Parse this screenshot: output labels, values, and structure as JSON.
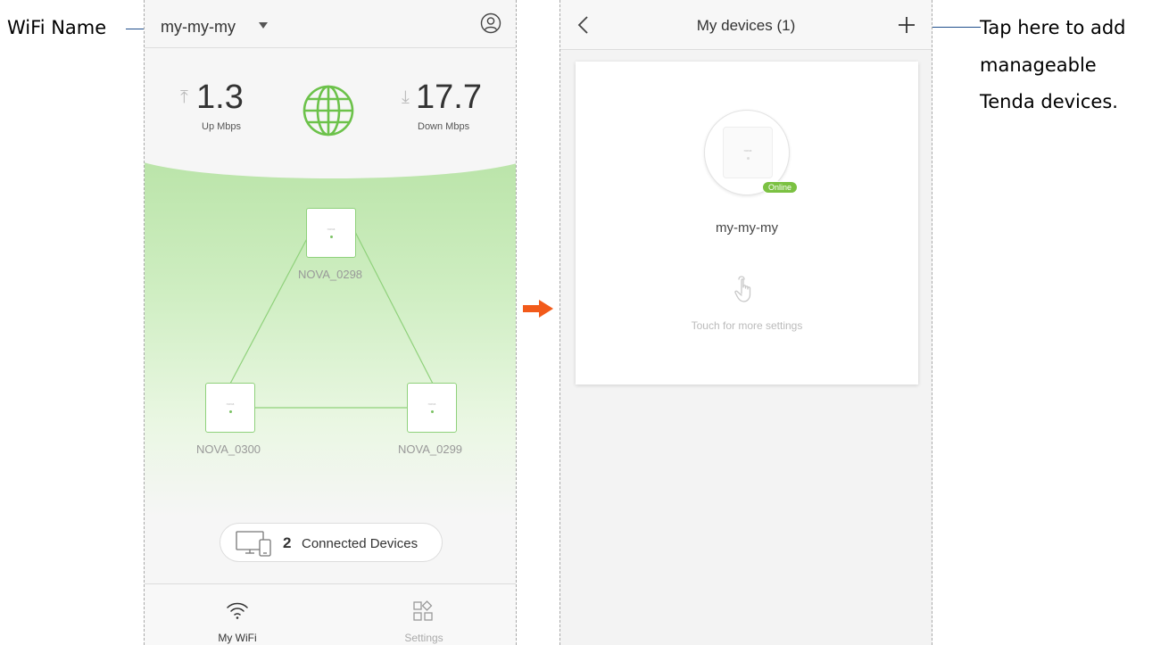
{
  "annotations": {
    "wifi_name": "WiFi Name",
    "add_hint": [
      "Tap here to add",
      "manageable",
      "Tenda devices."
    ]
  },
  "colors": {
    "accent_green": "#7bc142",
    "arrow_orange": "#f25a1a",
    "annotation_line": "#1f4e8c"
  },
  "my_wifi_screen": {
    "header": {
      "wifi_name": "my-my-my",
      "account_icon": "user-circle-icon"
    },
    "speed": {
      "up": {
        "value": "1.3",
        "label": "Up Mbps"
      },
      "down": {
        "value": "17.7",
        "label": "Down Mbps"
      },
      "status_icon": "globe-icon"
    },
    "topology": {
      "nodes": [
        {
          "id": "top",
          "label": "NOVA_0298",
          "brand": "nova"
        },
        {
          "id": "left",
          "label": "NOVA_0300",
          "brand": "nova"
        },
        {
          "id": "right",
          "label": "NOVA_0299",
          "brand": "nova"
        }
      ]
    },
    "connected": {
      "count": "2",
      "label": "Connected Devices"
    },
    "tabs": [
      {
        "label": "My WiFi",
        "icon": "wifi-icon",
        "active": true
      },
      {
        "label": "Settings",
        "icon": "settings-grid-icon",
        "active": false
      }
    ]
  },
  "my_devices_screen": {
    "header": {
      "title": "My devices (1)",
      "back_icon": "chevron-left-icon",
      "add_icon": "plus-icon"
    },
    "device": {
      "name": "my-my-my",
      "status": "Online",
      "brand": "nova",
      "hint": "Touch for more settings"
    }
  }
}
